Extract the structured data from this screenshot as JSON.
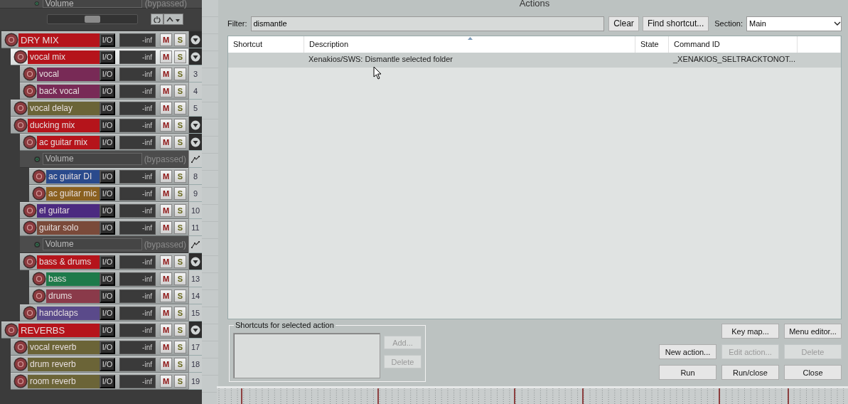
{
  "top_envelope": {
    "name": "Volume",
    "status": "(bypassed)",
    "fader": {
      "level": 0.5
    }
  },
  "tracks": [
    {
      "kind": "folder",
      "name": "DRY MIX",
      "color": "#b5141b",
      "selected": false,
      "io": "I/O",
      "meter": "-inf",
      "mute": "M",
      "solo": "S",
      "children": [
        {
          "kind": "folder",
          "name": "vocal mix",
          "color": "#b5141b",
          "selected": true,
          "io": "I/O",
          "meter": "-inf",
          "mute": "M",
          "solo": "S",
          "children": [
            {
              "kind": "track",
              "name": "vocal",
              "color": "#782a56",
              "selected": false,
              "io": "I/O",
              "meter": "-inf",
              "mute": "M",
              "solo": "S",
              "number": "3"
            },
            {
              "kind": "track",
              "name": "back vocal",
              "color": "#782a56",
              "selected": false,
              "io": "I/O",
              "meter": "-inf",
              "mute": "M",
              "solo": "S",
              "number": "4"
            }
          ]
        },
        {
          "kind": "track",
          "name": "vocal delay",
          "color": "#6b6437",
          "selected": false,
          "io": "I/O",
          "meter": "-inf",
          "mute": "M",
          "solo": "S",
          "number": "5"
        },
        {
          "kind": "folder",
          "name": "ducking mix",
          "color": "#b5141b",
          "selected": false,
          "io": "I/O",
          "meter": "-inf",
          "mute": "M",
          "solo": "S",
          "children": [
            {
              "kind": "folder",
              "name": "ac guitar mix",
              "color": "#b5141b",
              "selected": false,
              "io": "I/O",
              "meter": "-inf",
              "mute": "M",
              "solo": "S",
              "children": [
                {
                  "kind": "envelope",
                  "name": "Volume",
                  "status": "(bypassed)"
                },
                {
                  "kind": "track",
                  "name": "ac guitar DI",
                  "color": "#2a4a8c",
                  "selected": false,
                  "io": "I/O",
                  "meter": "-inf",
                  "mute": "M",
                  "solo": "S",
                  "number": "8"
                },
                {
                  "kind": "track",
                  "name": "ac guitar mic",
                  "color": "#8a6020",
                  "selected": false,
                  "io": "I/O",
                  "meter": "-inf",
                  "mute": "M",
                  "solo": "S",
                  "number": "9"
                }
              ]
            },
            {
              "kind": "track",
              "name": "el guitar",
              "color": "#4b2a80",
              "selected": false,
              "io": "I/O",
              "meter": "-inf",
              "mute": "M",
              "solo": "S",
              "number": "10"
            },
            {
              "kind": "track",
              "name": "guitar solo",
              "color": "#7a4a3a",
              "selected": false,
              "io": "I/O",
              "meter": "-inf",
              "mute": "M",
              "solo": "S",
              "number": "11",
              "children": [
                {
                  "kind": "envelope",
                  "name": "Volume",
                  "status": "(bypassed)"
                }
              ]
            },
            {
              "kind": "folder",
              "name": "bass & drums",
              "color": "#b5141b",
              "selected": false,
              "io": "I/O",
              "meter": "-inf",
              "mute": "M",
              "solo": "S",
              "children": [
                {
                  "kind": "track",
                  "name": "bass",
                  "color": "#1e7a4a",
                  "selected": false,
                  "io": "I/O",
                  "meter": "-inf",
                  "mute": "M",
                  "solo": "S",
                  "number": "13"
                },
                {
                  "kind": "track",
                  "name": "drums",
                  "color": "#8a3a4a",
                  "selected": false,
                  "io": "I/O",
                  "meter": "-inf",
                  "mute": "M",
                  "solo": "S",
                  "number": "14"
                }
              ]
            },
            {
              "kind": "track",
              "name": "handclaps",
              "color": "#5a4a8a",
              "selected": false,
              "io": "I/O",
              "meter": "-inf",
              "mute": "M",
              "solo": "S",
              "number": "15"
            }
          ]
        }
      ]
    },
    {
      "kind": "folder",
      "name": "REVERBS",
      "color": "#b5141b",
      "selected": false,
      "io": "I/O",
      "meter": "-inf",
      "mute": "M",
      "solo": "S",
      "children": [
        {
          "kind": "track",
          "name": "vocal reverb",
          "color": "#6b6437",
          "selected": false,
          "io": "I/O",
          "meter": "-inf",
          "mute": "M",
          "solo": "S",
          "number": "17"
        },
        {
          "kind": "track",
          "name": "drum reverb",
          "color": "#6b6437",
          "selected": false,
          "io": "I/O",
          "meter": "-inf",
          "mute": "M",
          "solo": "S",
          "number": "18"
        },
        {
          "kind": "track",
          "name": "room reverb",
          "color": "#6b6437",
          "selected": false,
          "io": "I/O",
          "meter": "-inf",
          "mute": "M",
          "solo": "S",
          "number": "19"
        }
      ]
    }
  ],
  "dialog": {
    "title": "Actions",
    "filter": {
      "label": "Filter:",
      "value": "dismantle"
    },
    "clear_button": "Clear",
    "find_shortcut_button": "Find shortcut...",
    "section": {
      "label": "Section:",
      "value": "Main"
    },
    "table": {
      "columns": [
        "Shortcut",
        "Description",
        "State",
        "Command ID"
      ],
      "rows": [
        {
          "cells": [
            "",
            "Xenakios/SWS: Dismantle selected folder",
            "",
            "_XENAKIOS_SELTRACKTONOT..."
          ],
          "selected": true
        }
      ]
    },
    "shortcuts_group": {
      "title": "Shortcuts for selected action",
      "buttons": [
        {
          "label": "Add...",
          "disabled": true
        },
        {
          "label": "Delete",
          "disabled": true
        }
      ]
    },
    "button_rows": [
      [
        {
          "label": "Key map...",
          "disabled": false
        },
        {
          "label": "Menu editor...",
          "disabled": false
        }
      ],
      [
        {
          "label": "New action...",
          "disabled": false
        },
        {
          "label": "Edit action...",
          "disabled": true
        },
        {
          "label": "Delete",
          "disabled": true
        }
      ],
      [
        {
          "label": "Run",
          "disabled": false
        },
        {
          "label": "Run/close",
          "disabled": false
        },
        {
          "label": "Close",
          "disabled": false
        }
      ]
    ]
  }
}
